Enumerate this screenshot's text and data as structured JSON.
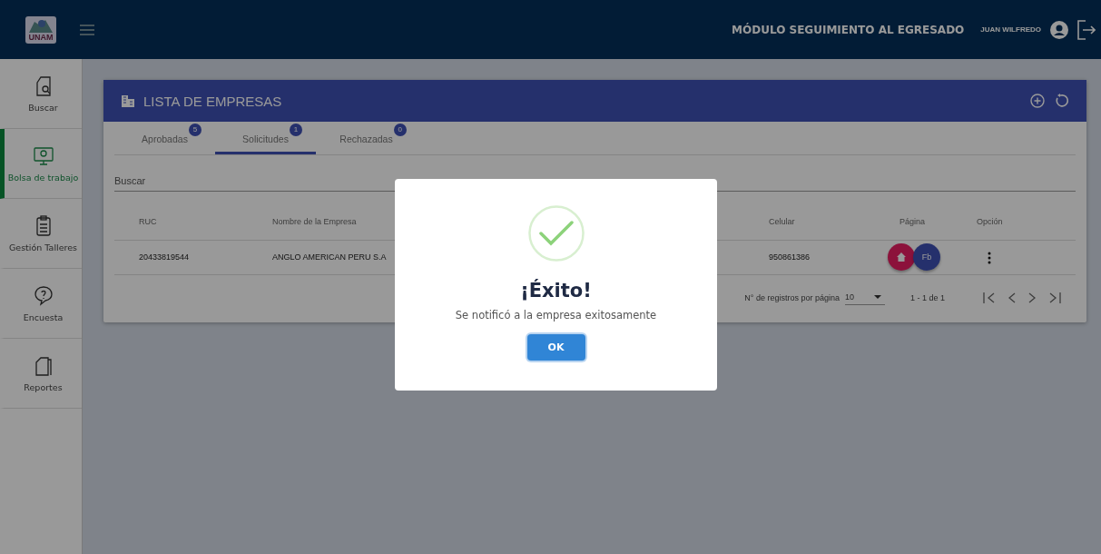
{
  "header": {
    "logo_text": "UNAM",
    "module_title": "MÓDULO SEGUIMIENTO AL EGRESADO",
    "user_name": "JUAN WILFREDO"
  },
  "sidebar": {
    "items": [
      {
        "label": "Buscar",
        "kind": "search",
        "selected": false
      },
      {
        "label": "Bolsa de trabajo",
        "kind": "jobs",
        "selected": true
      },
      {
        "label": "Gestión Talleres",
        "kind": "workshops",
        "selected": false
      },
      {
        "label": "Encuesta",
        "kind": "survey",
        "selected": false
      },
      {
        "label": "Reportes",
        "kind": "reports",
        "selected": false
      }
    ]
  },
  "card": {
    "title": "LISTA DE EMPRESAS",
    "tabs": [
      {
        "label": "Aprobadas",
        "count": "5",
        "selected": false
      },
      {
        "label": "Solicitudes",
        "count": "1",
        "selected": true
      },
      {
        "label": "Rechazadas",
        "count": "0",
        "selected": false
      }
    ],
    "search": {
      "placeholder": "Buscar"
    },
    "table": {
      "columns": [
        {
          "label": "RUC",
          "kind": "text"
        },
        {
          "label": "Nombre de la Empresa",
          "kind": "text"
        },
        {
          "label": "Celular",
          "kind": "text"
        },
        {
          "label": "Página",
          "kind": "links"
        },
        {
          "label": "Opción",
          "kind": "menu"
        }
      ],
      "rows": [
        {
          "cells": [
            "20433819544",
            "ANGLO AMERICAN PERU S.A",
            "950861386",
            "Fb"
          ]
        }
      ]
    },
    "pagination": {
      "rows_per_page_label": "N° de registros por página",
      "rows_per_page": "10",
      "range": "1 - 1 de 1"
    }
  },
  "dialog": {
    "title": "¡Éxito!",
    "message": "Se notificó a la empresa exitosamente",
    "button": "OK"
  }
}
